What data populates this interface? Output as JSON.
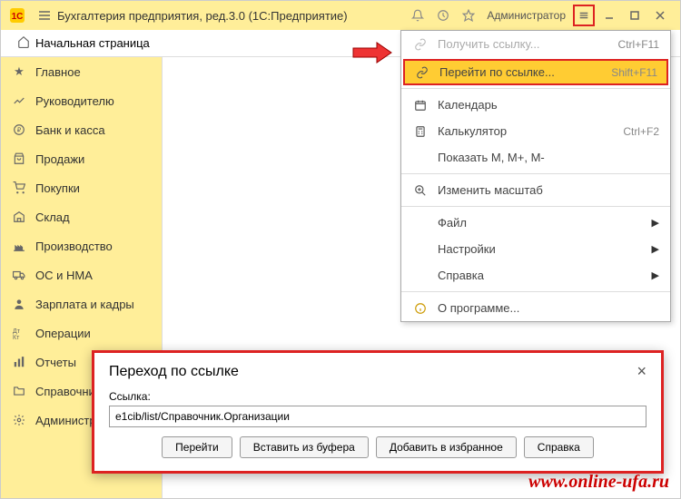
{
  "titlebar": {
    "title": "Бухгалтерия предприятия, ред.3.0  (1С:Предприятие)",
    "user": "Администратор"
  },
  "tab": {
    "label": "Начальная страница"
  },
  "sidebar": {
    "items": [
      {
        "label": "Главное"
      },
      {
        "label": "Руководителю"
      },
      {
        "label": "Банк и касса"
      },
      {
        "label": "Продажи"
      },
      {
        "label": "Покупки"
      },
      {
        "label": "Склад"
      },
      {
        "label": "Производство"
      },
      {
        "label": "ОС и НМА"
      },
      {
        "label": "Зарплата и кадры"
      },
      {
        "label": "Операции"
      },
      {
        "label": "Отчеты"
      },
      {
        "label": "Справочники"
      },
      {
        "label": "Администрирование"
      }
    ]
  },
  "dropdown": {
    "get_link": {
      "label": "Получить ссылку...",
      "shortcut": "Ctrl+F11"
    },
    "go_link": {
      "label": "Перейти по ссылке...",
      "shortcut": "Shift+F11"
    },
    "calendar": {
      "label": "Календарь"
    },
    "calculator": {
      "label": "Калькулятор",
      "shortcut": "Ctrl+F2"
    },
    "show_m": {
      "label": "Показать M, M+, M-"
    },
    "zoom": {
      "label": "Изменить масштаб"
    },
    "file": {
      "label": "Файл"
    },
    "settings": {
      "label": "Настройки"
    },
    "help": {
      "label": "Справка"
    },
    "about": {
      "label": "О программе..."
    }
  },
  "dialog": {
    "title": "Переход по ссылке",
    "label": "Ссылка:",
    "value": "e1cib/list/Справочник.Организации",
    "btn_go": "Перейти",
    "btn_paste": "Вставить из буфера",
    "btn_fav": "Добавить в избранное",
    "btn_help": "Справка"
  },
  "watermark": "www.online-ufa.ru"
}
